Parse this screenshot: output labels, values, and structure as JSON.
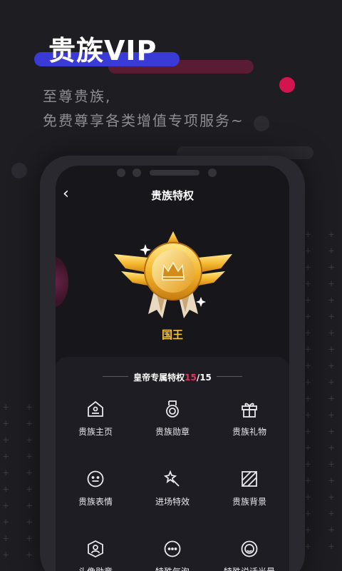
{
  "hero": {
    "title": "贵族VIP",
    "subtitle_line1": "至尊贵族,",
    "subtitle_line2": "免费尊享各类增值专项服务~"
  },
  "phone": {
    "header_title": "贵族特权",
    "back_icon": "chevron-left-icon",
    "rank_name": "国王",
    "section_title_prefix": "皇帝专属特权",
    "section_count_current": "15",
    "section_count_total": "/15",
    "privileges": [
      {
        "label": "贵族主页",
        "icon": "homepage-icon"
      },
      {
        "label": "贵族勋章",
        "icon": "medal-icon"
      },
      {
        "label": "贵族礼物",
        "icon": "gift-icon"
      },
      {
        "label": "贵族表情",
        "icon": "emoji-icon"
      },
      {
        "label": "进场特效",
        "icon": "magic-wand-icon"
      },
      {
        "label": "贵族背景",
        "icon": "background-icon"
      },
      {
        "label": "头像勋章",
        "icon": "avatar-badge-icon"
      },
      {
        "label": "特殊气泡",
        "icon": "chat-bubble-icon"
      },
      {
        "label": "特殊说话光晕",
        "icon": "halo-icon"
      }
    ]
  },
  "colors": {
    "accent_red": "#e6355d",
    "accent_blue": "#3a3bd6",
    "gold": "#f2c23a"
  }
}
